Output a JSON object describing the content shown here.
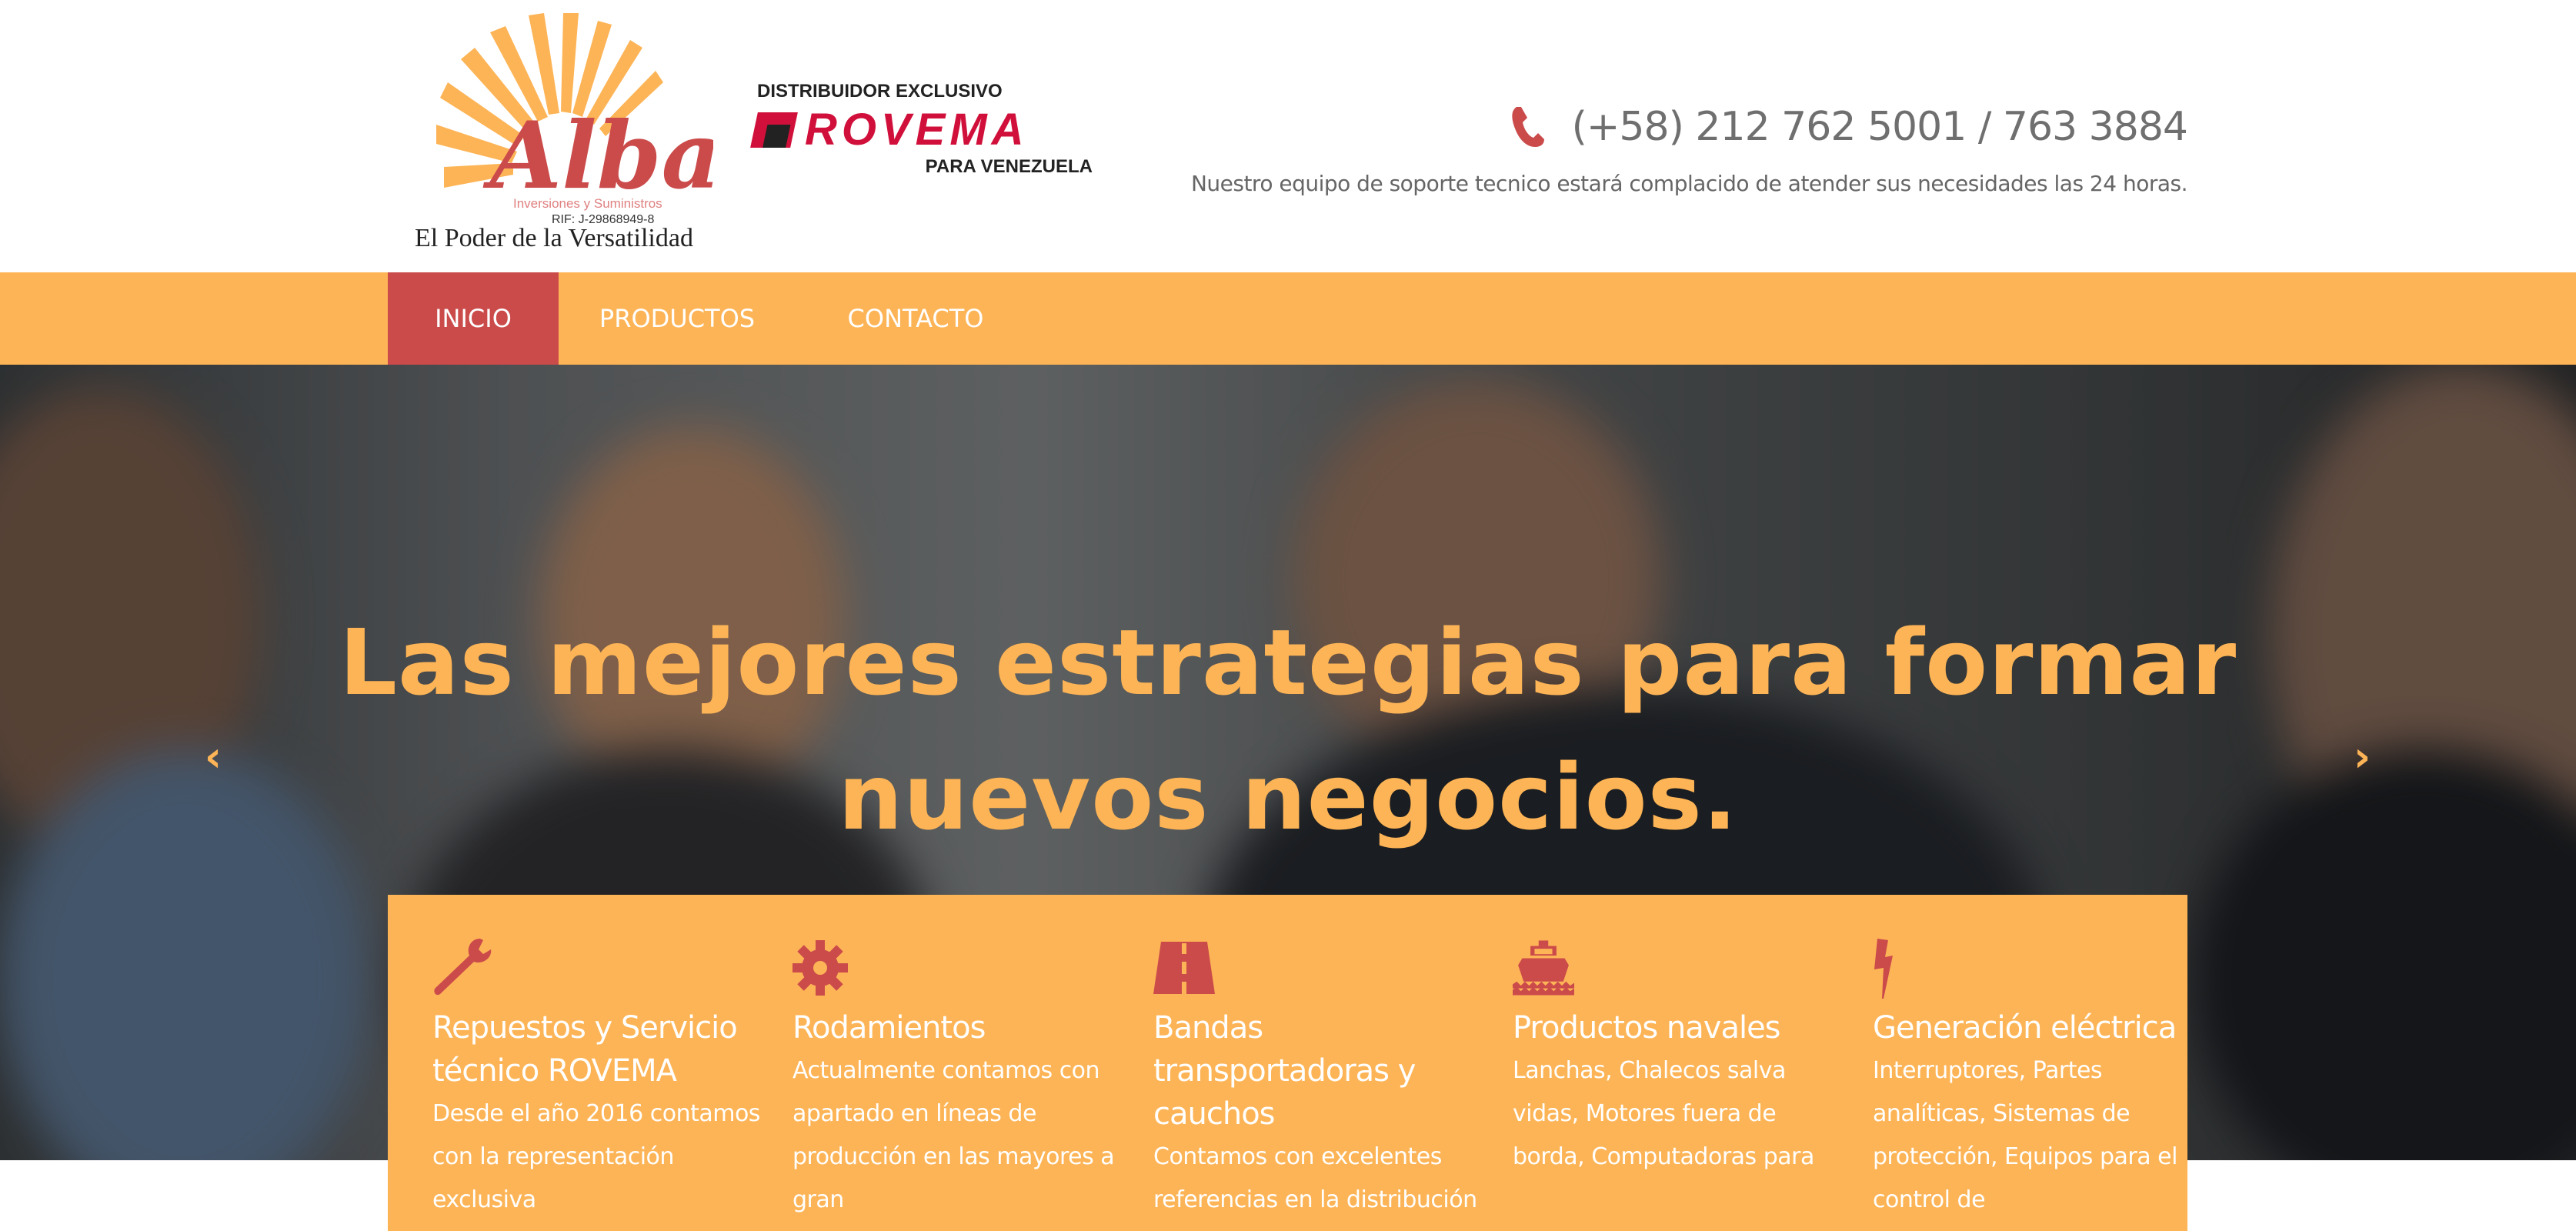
{
  "header": {
    "logo": {
      "name": "Alba",
      "subtitle": "Inversiones y Suministros",
      "rif": "RIF: J-29868949-8",
      "tagline": "El Poder de la Versatilidad"
    },
    "partner": {
      "top": "DISTRIBUIDOR EXCLUSIVO",
      "brand": "ROVEMA",
      "bottom": "PARA VENEZUELA"
    },
    "phone": "(+58) 212 762 5001 / 763 3884",
    "support_text": "Nuestro equipo de soporte tecnico estará complacido de atender sus necesidades las 24 horas."
  },
  "nav": {
    "items": [
      {
        "label": "INICIO",
        "active": true
      },
      {
        "label": "PRODUCTOS"
      },
      {
        "label": "CONTACTO"
      }
    ]
  },
  "hero": {
    "line1": "Las mejores estrategias para formar",
    "line2": "nuevos negocios.",
    "prev": "‹",
    "next": "›"
  },
  "features": [
    {
      "icon": "wrench-icon",
      "title": "Repuestos y Servicio técnico ROVEMA",
      "body": "Desde el año 2016 contamos con la representación exclusiva"
    },
    {
      "icon": "gear-icon",
      "title": "Rodamientos",
      "body": "Actualmente contamos con apartado en líneas de producción en las mayores a gran"
    },
    {
      "icon": "road-icon",
      "title": "Bandas transportadoras y cauchos",
      "body": "Contamos con excelentes referencias en la distribución de bandas"
    },
    {
      "icon": "ship-icon",
      "title": "Productos navales",
      "body": "Lanchas, Chalecos salva vidas, Motores fuera de borda, Computadoras para"
    },
    {
      "icon": "bolt-icon",
      "title": "Generación eléctrica",
      "body": "Interruptores, Partes analíticas, Sistemas de protección, Equipos para el control de"
    }
  ],
  "colors": {
    "accent": "#fdb456",
    "brand_red": "#cb4b4b",
    "text_gray": "#6f6f6f"
  }
}
